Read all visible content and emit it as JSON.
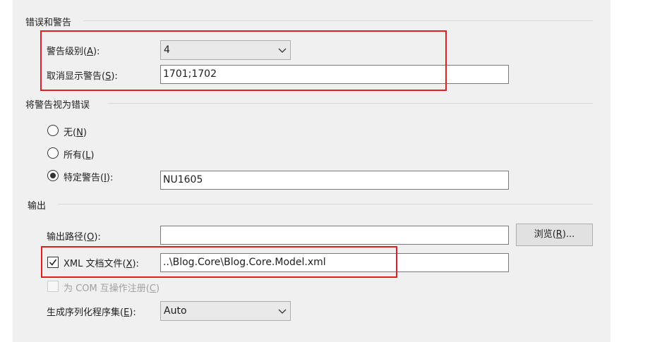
{
  "errors_group": {
    "title": "错误和警告",
    "warning_level": {
      "label_prefix": "警告级别(",
      "mnemonic": "A",
      "label_suffix": "):",
      "value": "4"
    },
    "suppress_warnings": {
      "label_prefix": "取消显示警告(",
      "mnemonic": "S",
      "label_suffix": "):",
      "value": "1701;1702"
    }
  },
  "treat_group": {
    "title": "将警告视为错误",
    "none": {
      "label_prefix": "无(",
      "mnemonic": "N",
      "label_suffix": ")",
      "checked": false
    },
    "all": {
      "label_prefix": "所有(",
      "mnemonic": "L",
      "label_suffix": ")",
      "checked": false
    },
    "specific": {
      "label_prefix": "特定警告(",
      "mnemonic": "I",
      "label_suffix": "):",
      "checked": true,
      "value": "NU1605"
    }
  },
  "output_group": {
    "title": "输出",
    "output_path": {
      "label_prefix": "输出路径(",
      "mnemonic": "O",
      "label_suffix": "):",
      "value": ""
    },
    "browse_button": {
      "label_prefix": "浏览(",
      "mnemonic": "R",
      "label_suffix": ")..."
    },
    "xml_doc": {
      "label_prefix": "XML 文档文件(",
      "mnemonic": "X",
      "label_suffix": "):",
      "checked": true,
      "value": "..\\Blog.Core\\Blog.Core.Model.xml"
    },
    "com_interop": {
      "label_prefix": "为 COM 互操作注册(",
      "mnemonic": "C",
      "label_suffix": ")",
      "checked": false,
      "enabled": false
    },
    "serialization": {
      "label_prefix": "生成序列化程序集(",
      "mnemonic": "E",
      "label_suffix": "):",
      "value": "Auto"
    }
  },
  "colors": {
    "highlight": "#e02020",
    "background": "#f0f0f0"
  },
  "icons": {
    "dropdown": "chevron-down-icon",
    "check": "check-icon"
  }
}
